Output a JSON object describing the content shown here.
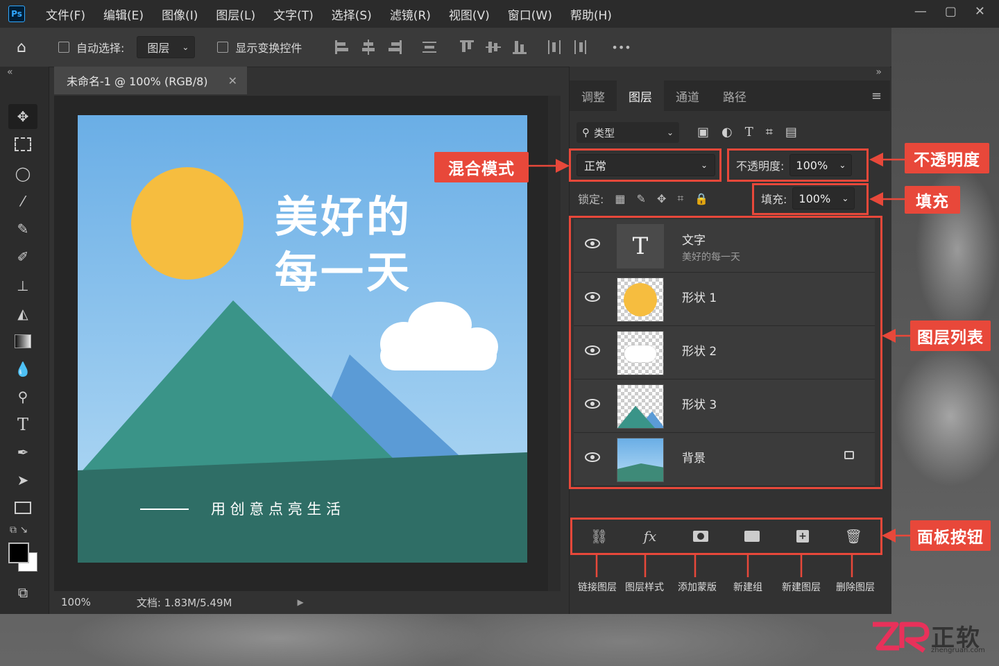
{
  "app": {
    "logo_text": "Ps"
  },
  "menu": [
    "文件(F)",
    "编辑(E)",
    "图像(I)",
    "图层(L)",
    "文字(T)",
    "选择(S)",
    "滤镜(R)",
    "视图(V)",
    "窗口(W)",
    "帮助(H)"
  ],
  "options_bar": {
    "auto_select_label": "自动选择:",
    "auto_select_value": "图层",
    "show_transform_label": "显示变换控件",
    "more": "•••"
  },
  "document": {
    "tab_title": "未命名-1 @ 100% (RGB/8)",
    "zoom": "100%",
    "doc_info": "文档: 1.83M/5.49M"
  },
  "artwork": {
    "headline_line1": "美好的",
    "headline_line2": "每一天",
    "tagline": "用 创 意 点 亮 生 活"
  },
  "panel": {
    "tabs": [
      "调整",
      "图层",
      "通道",
      "路径"
    ],
    "active_tab": "图层",
    "filter_label": "类型",
    "blend_mode": "正常",
    "opacity_label": "不透明度:",
    "opacity_value": "100%",
    "lock_label": "锁定:",
    "fill_label": "填充:",
    "fill_value": "100%",
    "layers": [
      {
        "name": "文字",
        "sub": "美好的每一天"
      },
      {
        "name": "形状 1"
      },
      {
        "name": "形状 2"
      },
      {
        "name": "形状 3"
      },
      {
        "name": "背景"
      }
    ],
    "button_labels": [
      "链接图层",
      "图层样式",
      "添加蒙版",
      "新建组",
      "新建图层",
      "删除图层"
    ]
  },
  "annotations": {
    "blend_mode": "混合模式",
    "opacity": "不透明度",
    "fill": "填充",
    "layer_list": "图层列表",
    "panel_buttons": "面板按钮"
  },
  "watermark": {
    "brand": "正软",
    "url": "zhengruan.com"
  },
  "colors": {
    "accent_red": "#e8483a",
    "sky": "#6aaee6",
    "sun": "#f6bd3f",
    "mountain": "#3a9488",
    "ground": "#2f6e66"
  }
}
